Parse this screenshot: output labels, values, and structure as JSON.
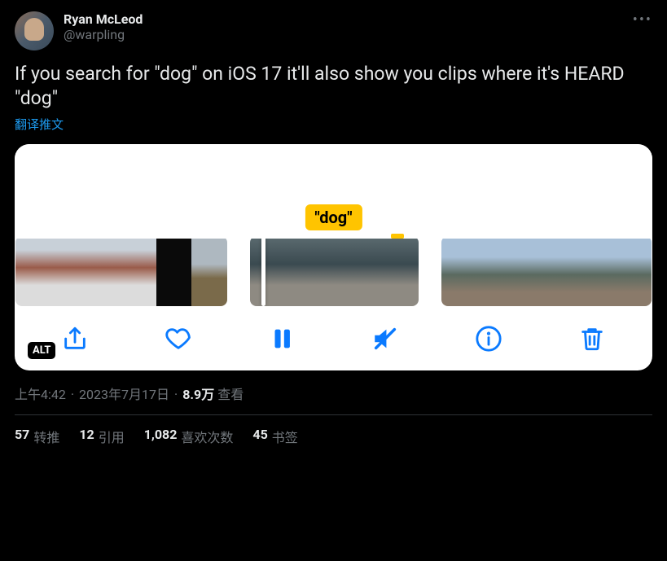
{
  "header": {
    "display_name": "Ryan McLeod",
    "handle": "@warpling"
  },
  "body": "If you search for \"dog\" on iOS 17 it'll also show you clips where it's HEARD \"dog\"",
  "translate_label": "翻译推文",
  "media": {
    "badge_text": "\"dog\"",
    "alt_label": "ALT",
    "toolbar": {
      "share": "share",
      "like": "like",
      "pause": "pause",
      "mute": "mute",
      "info": "info",
      "trash": "trash"
    }
  },
  "meta": {
    "time": "上午4:42",
    "date": "2023年7月17日",
    "views_count": "8.9万",
    "views_label": "查看"
  },
  "stats": {
    "retweets": {
      "count": "57",
      "label": "转推"
    },
    "quotes": {
      "count": "12",
      "label": "引用"
    },
    "likes": {
      "count": "1,082",
      "label": "喜欢次数"
    },
    "bookmarks": {
      "count": "45",
      "label": "书签"
    }
  }
}
